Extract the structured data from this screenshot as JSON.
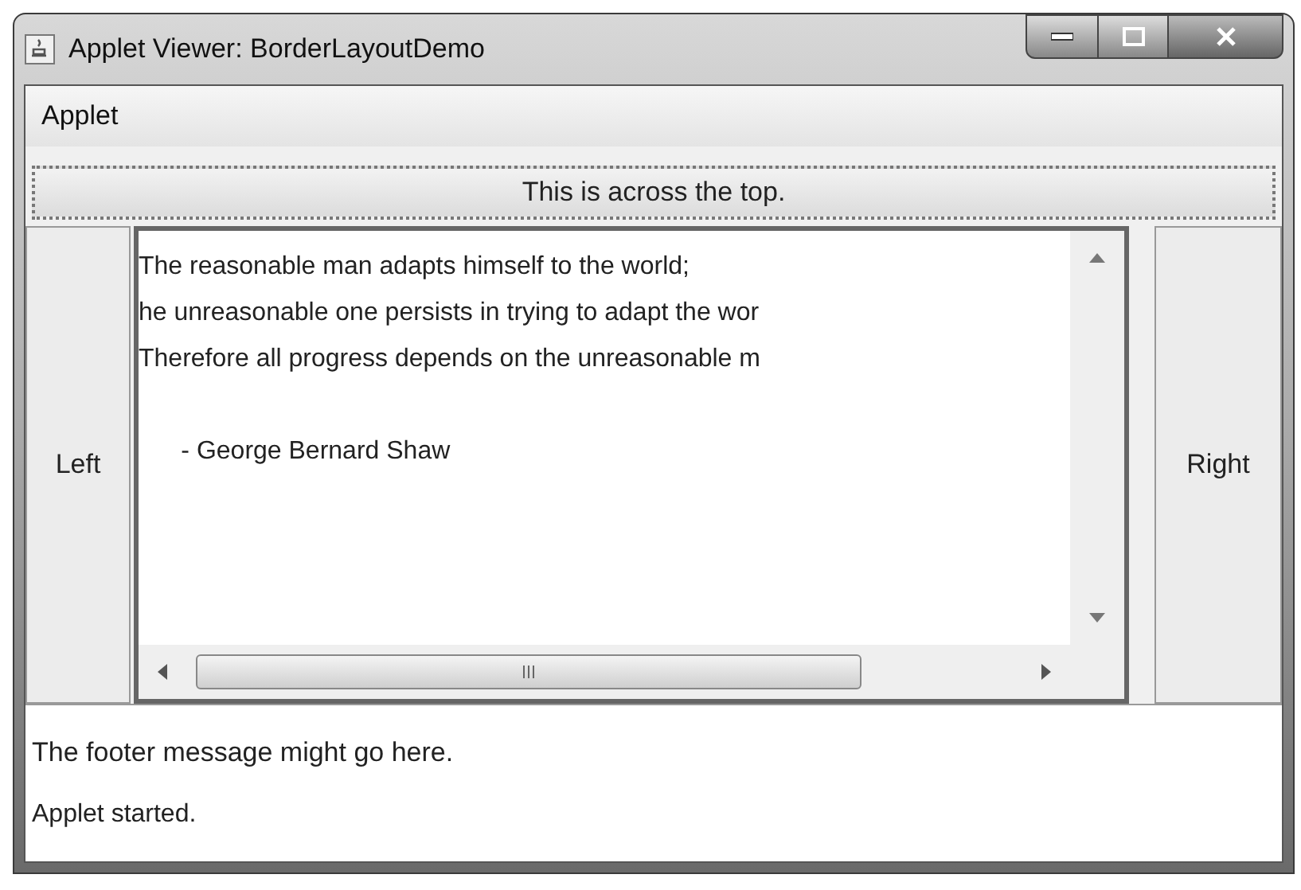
{
  "window": {
    "title": "Applet Viewer: BorderLayoutDemo"
  },
  "menu_bar": {
    "items": [
      "Applet"
    ]
  },
  "top_button": {
    "label": "This is across the top."
  },
  "left_button": {
    "label": "Left"
  },
  "right_button": {
    "label": "Right"
  },
  "text_area": {
    "lines": [
      "The reasonable man adapts himself to the world;",
      "he unreasonable one persists in trying to adapt the wor",
      "Therefore all progress depends on the unreasonable m"
    ],
    "attribution": "      - George Bernard Shaw"
  },
  "footer": {
    "message": "The footer message might go here."
  },
  "status_bar": {
    "text": "Applet started."
  }
}
